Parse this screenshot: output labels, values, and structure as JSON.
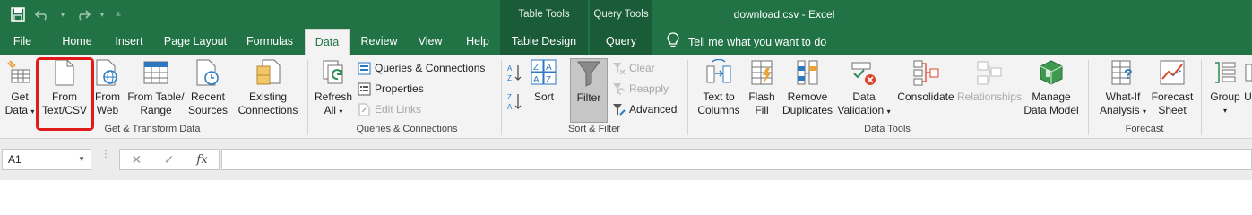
{
  "titlebar": {
    "doc_title": "download.csv  -  Excel",
    "context_table_tools": "Table Tools",
    "context_query_tools": "Query Tools"
  },
  "tabs": [
    "File",
    "Home",
    "Insert",
    "Page Layout",
    "Formulas",
    "Data",
    "Review",
    "View",
    "Help",
    "Table Design",
    "Query"
  ],
  "active_tab": "Data",
  "tell_me": "Tell me what you want to do",
  "ribbon": {
    "get_transform": {
      "label": "Get & Transform Data",
      "get_data": [
        "Get",
        "Data"
      ],
      "from_text": [
        "From",
        "Text/CSV"
      ],
      "from_web": [
        "From",
        "Web"
      ],
      "from_table": [
        "From Table/",
        "Range"
      ],
      "recent_sources": [
        "Recent",
        "Sources"
      ],
      "existing_connections": [
        "Existing",
        "Connections"
      ]
    },
    "queries_connections": {
      "label": "Queries & Connections",
      "refresh_all": [
        "Refresh",
        "All"
      ],
      "queries_and_connections": "Queries & Connections",
      "properties": "Properties",
      "edit_links": "Edit Links"
    },
    "sort_filter": {
      "label": "Sort & Filter",
      "sort": "Sort",
      "filter": "Filter",
      "clear": "Clear",
      "reapply": "Reapply",
      "advanced": "Advanced"
    },
    "data_tools": {
      "label": "Data Tools",
      "text_to_columns": [
        "Text to",
        "Columns"
      ],
      "flash_fill": [
        "Flash",
        "Fill"
      ],
      "remove_duplicates": [
        "Remove",
        "Duplicates"
      ],
      "data_validation": [
        "Data",
        "Validation"
      ],
      "consolidate": "Consolidate",
      "relationships": "Relationships",
      "manage_data_model": [
        "Manage",
        "Data Model"
      ]
    },
    "forecast": {
      "label": "Forecast",
      "what_if": [
        "What-If",
        "Analysis"
      ],
      "forecast_sheet": [
        "Forecast",
        "Sheet"
      ]
    },
    "outline": {
      "group": "Group",
      "ungroup": "U"
    }
  },
  "formula_bar": {
    "name_box": "A1",
    "fx": "fx",
    "formula": ""
  },
  "colors": {
    "excel_green": "#217346",
    "highlight": "#e01b1b"
  }
}
